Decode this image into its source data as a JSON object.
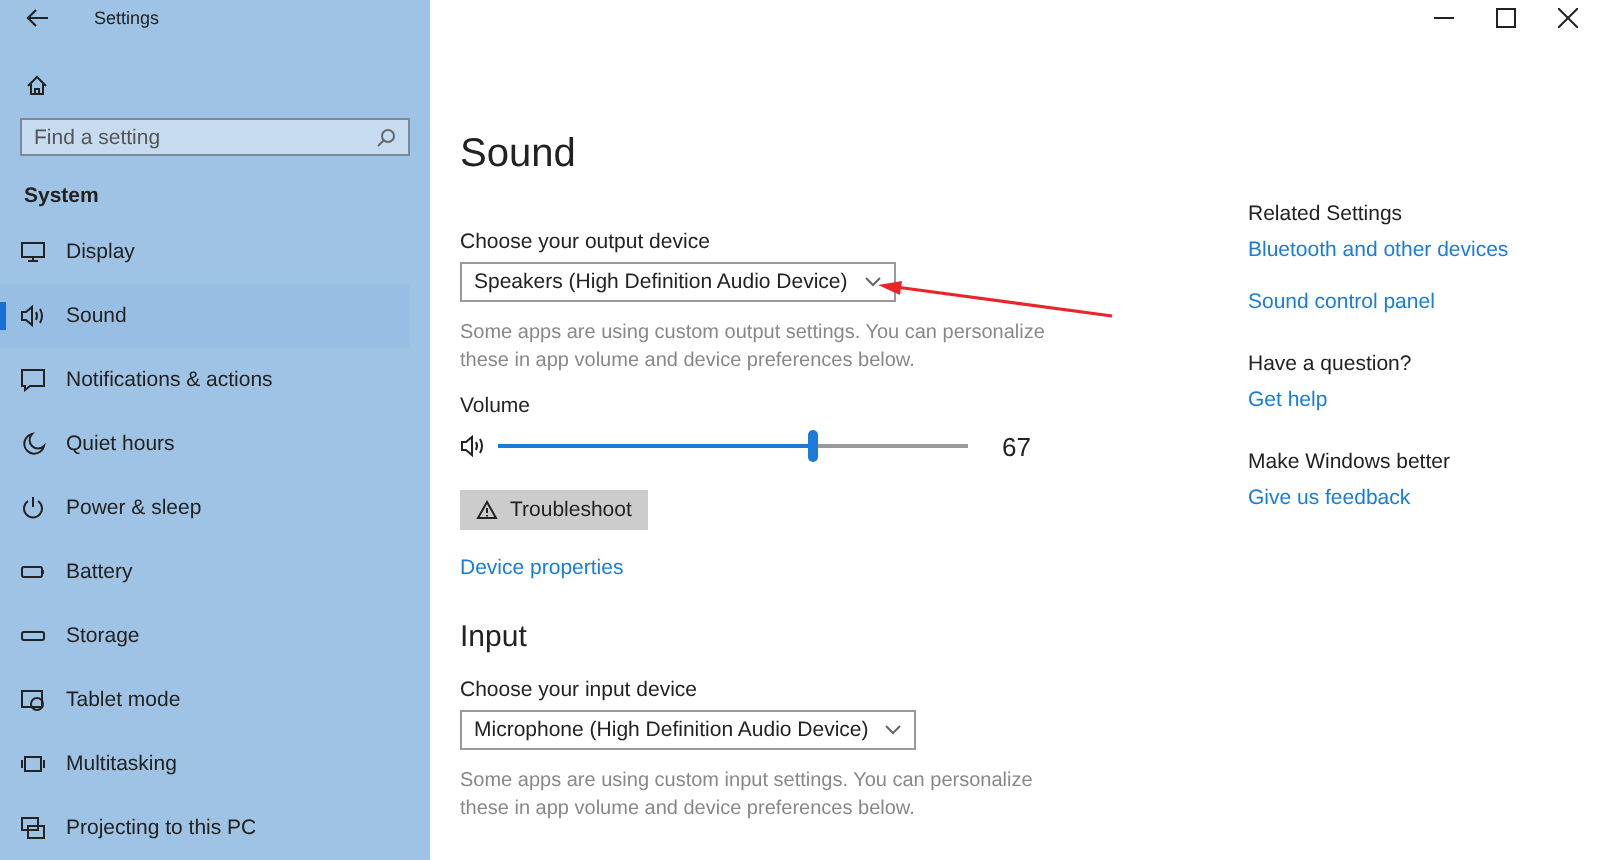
{
  "window": {
    "title": "Settings"
  },
  "sidebar": {
    "search": {
      "placeholder": "Find a setting"
    },
    "heading": "System",
    "items": [
      {
        "label": "Display",
        "selected": false
      },
      {
        "label": "Sound",
        "selected": true
      },
      {
        "label": "Notifications & actions",
        "selected": false
      },
      {
        "label": "Quiet hours",
        "selected": false
      },
      {
        "label": "Power & sleep",
        "selected": false
      },
      {
        "label": "Battery",
        "selected": false
      },
      {
        "label": "Storage",
        "selected": false
      },
      {
        "label": "Tablet mode",
        "selected": false
      },
      {
        "label": "Multitasking",
        "selected": false
      },
      {
        "label": "Projecting to this PC",
        "selected": false
      }
    ]
  },
  "page": {
    "title": "Sound",
    "output": {
      "label": "Choose your output device",
      "device": "Speakers (High Definition Audio Device)",
      "note": "Some apps are using custom output settings. You can personalize these in app volume and device preferences below.",
      "volume_label": "Volume",
      "volume": {
        "level": 0.67,
        "reading": "67"
      },
      "troubleshoot": "Troubleshoot",
      "link": "Device properties"
    },
    "input": {
      "title": "Input",
      "label": "Choose your input device",
      "device": "Microphone (High Definition Audio Device)",
      "note": "Some apps are using custom input settings. You can personalize these in app volume and device preferences below."
    }
  },
  "aside": [
    {
      "heading": "Related Settings",
      "links": [
        "Bluetooth and other devices",
        "Sound control panel"
      ]
    },
    {
      "heading": "Have a question?",
      "links": [
        "Get help"
      ]
    },
    {
      "heading": "Make Windows better",
      "links": [
        "Give us feedback"
      ]
    }
  ]
}
